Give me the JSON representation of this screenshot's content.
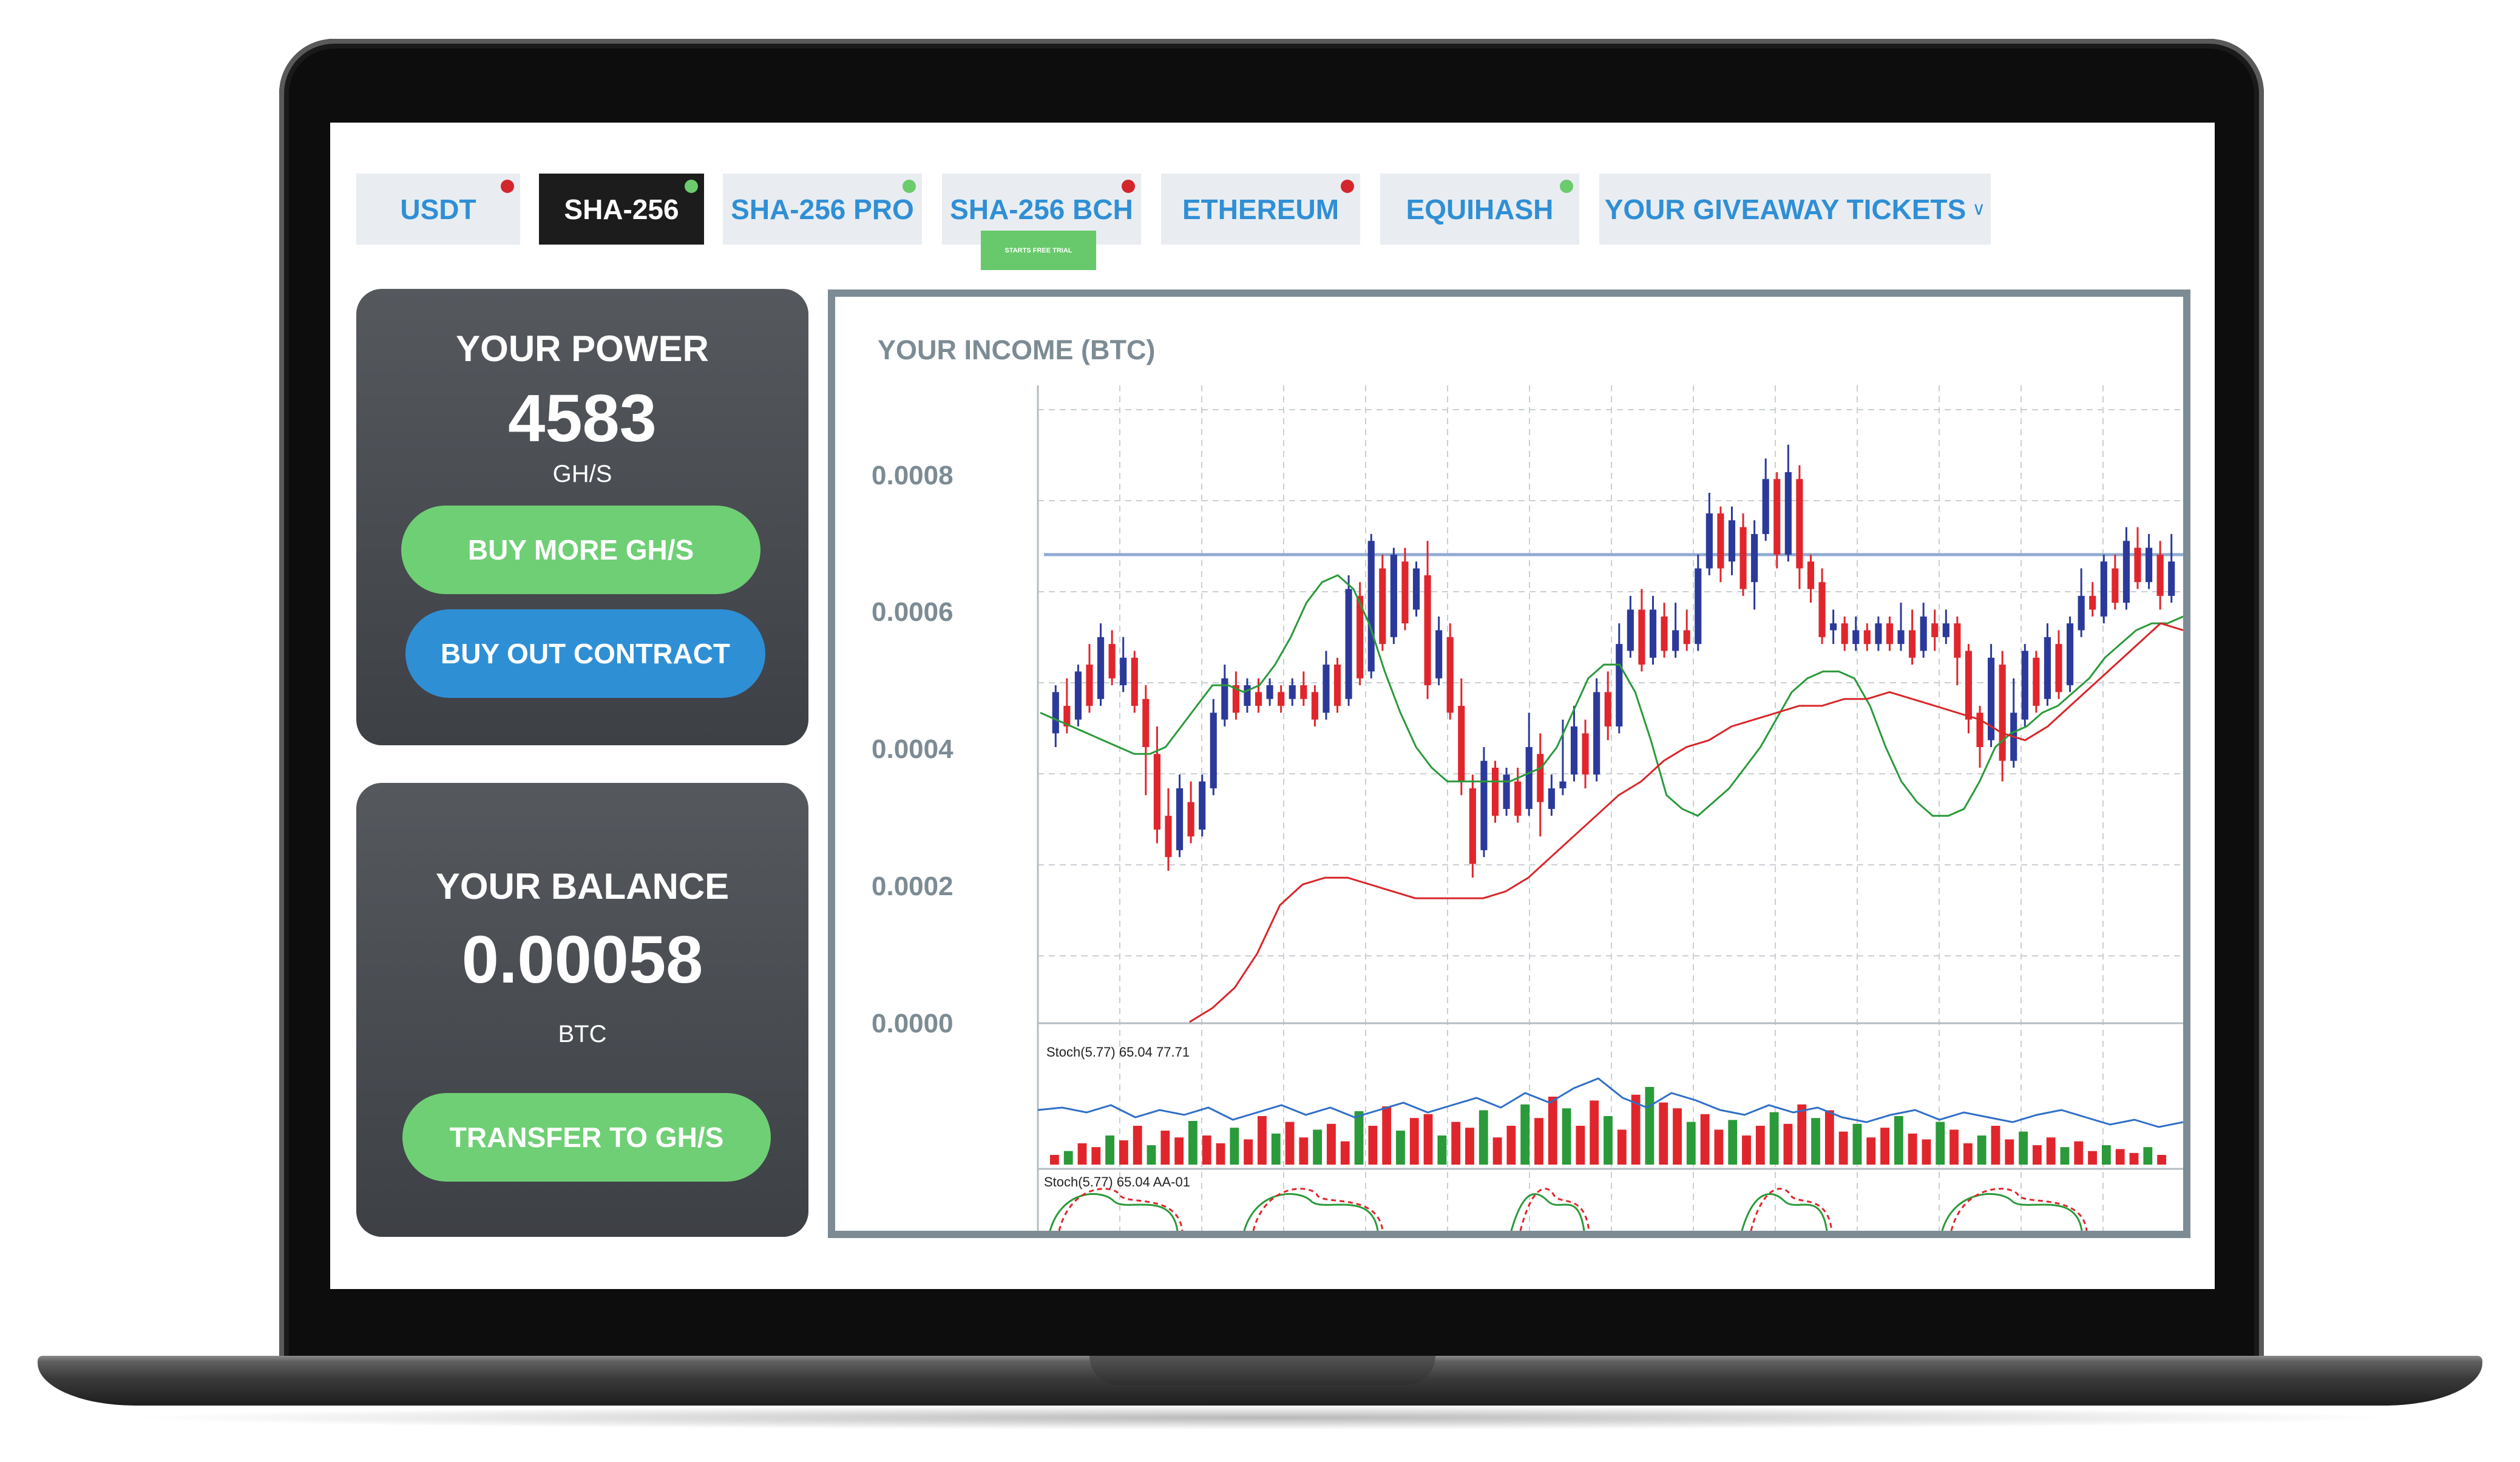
{
  "tabs": [
    {
      "label": "USDT",
      "status": "red",
      "active": false
    },
    {
      "label": "SHA-256",
      "status": "green",
      "active": true
    },
    {
      "label": "SHA-256 PRO",
      "status": "green",
      "active": false
    },
    {
      "label": "SHA-256 BCH",
      "status": "red",
      "active": false,
      "badge": "STARTS FREE TRIAL"
    },
    {
      "label": "ETHEREUM",
      "status": "red",
      "active": false
    },
    {
      "label": "EQUIHASH",
      "status": "green",
      "active": false
    },
    {
      "label": "YOUR GIVEAWAY TICKETS",
      "status": null,
      "active": false,
      "dropdown": true
    }
  ],
  "power": {
    "label": "YOUR POWER",
    "value": "4583",
    "unit": "GH/S",
    "buy_more_label": "BUY MORE GH/S",
    "buy_out_label": "BUY OUT CONTRACT"
  },
  "balance": {
    "label": "YOUR BALANCE",
    "value": "0.00058",
    "unit": "BTC",
    "transfer_label": "TRANSFER TO GH/S"
  },
  "chart": {
    "title": "YOUR INCOME (BTC)",
    "y_ticks": [
      "0.0008",
      "0.0006",
      "0.0004",
      "0.0002",
      "0.0000"
    ],
    "indicator1_label": "Stoch(5.77) 65.04 77.71",
    "indicator2_label": "Stoch(5.77) 65.04 AA-01"
  },
  "chart_data": {
    "type": "candlestick",
    "title": "YOUR INCOME (BTC)",
    "ylim": [
      0,
      0.00095
    ],
    "y_ticks": [
      0.0008,
      0.0006,
      0.0004,
      0.0002,
      0.0
    ],
    "reference_line": 0.00068,
    "grid": true,
    "colors": {
      "up": "#2b3a9a",
      "down": "#e0262c",
      "band": "#2a9a3a",
      "signal": "#d8262a",
      "ref": "#8faad4"
    },
    "candles": [
      [
        0.00042,
        0.00048,
        0.00049,
        0.0004
      ],
      [
        0.00046,
        0.00043,
        0.0005,
        0.00042
      ],
      [
        0.00044,
        0.00051,
        0.00052,
        0.00043
      ],
      [
        0.00052,
        0.00046,
        0.00055,
        0.00045
      ],
      [
        0.00047,
        0.00056,
        0.00058,
        0.00046
      ],
      [
        0.00055,
        0.0005,
        0.00057,
        0.00049
      ],
      [
        0.00049,
        0.00053,
        0.00056,
        0.00048
      ],
      [
        0.00053,
        0.00046,
        0.00054,
        0.00045
      ],
      [
        0.00047,
        0.0004,
        0.00049,
        0.00033
      ],
      [
        0.00039,
        0.00028,
        0.00043,
        0.00026
      ],
      [
        0.0003,
        0.00024,
        0.00034,
        0.00022
      ],
      [
        0.00025,
        0.00034,
        0.00036,
        0.00024
      ],
      [
        0.00032,
        0.00027,
        0.00035,
        0.00026
      ],
      [
        0.00028,
        0.00035,
        0.00036,
        0.00027
      ],
      [
        0.00034,
        0.00045,
        0.00047,
        0.00033
      ],
      [
        0.00044,
        0.0005,
        0.00052,
        0.00043
      ],
      [
        0.00049,
        0.00045,
        0.00051,
        0.00044
      ],
      [
        0.00046,
        0.00049,
        0.0005,
        0.00045
      ],
      [
        0.00048,
        0.00046,
        0.0005,
        0.00045
      ],
      [
        0.00047,
        0.00049,
        0.0005,
        0.00046
      ],
      [
        0.00048,
        0.00046,
        0.00049,
        0.00045
      ],
      [
        0.00047,
        0.00049,
        0.0005,
        0.00046
      ],
      [
        0.00049,
        0.00047,
        0.00051,
        0.00046
      ],
      [
        0.00048,
        0.00044,
        0.00049,
        0.00043
      ],
      [
        0.00045,
        0.00052,
        0.00054,
        0.00044
      ],
      [
        0.00052,
        0.00046,
        0.00053,
        0.00045
      ],
      [
        0.00047,
        0.00063,
        0.00065,
        0.00046
      ],
      [
        0.00062,
        0.0005,
        0.00064,
        0.00049
      ],
      [
        0.00051,
        0.0007,
        0.00071,
        0.0005
      ],
      [
        0.00066,
        0.00055,
        0.00068,
        0.00054
      ],
      [
        0.00056,
        0.00068,
        0.00069,
        0.00055
      ],
      [
        0.00067,
        0.00058,
        0.00069,
        0.00057
      ],
      [
        0.0006,
        0.00066,
        0.00067,
        0.00059
      ],
      [
        0.00065,
        0.00049,
        0.0007,
        0.00047
      ],
      [
        0.0005,
        0.00057,
        0.00059,
        0.00049
      ],
      [
        0.00056,
        0.00045,
        0.00058,
        0.00044
      ],
      [
        0.00046,
        0.00035,
        0.0005,
        0.00033
      ],
      [
        0.00034,
        0.00023,
        0.00036,
        0.00021
      ],
      [
        0.00025,
        0.00038,
        0.0004,
        0.00024
      ],
      [
        0.00037,
        0.0003,
        0.00038,
        0.00029
      ],
      [
        0.00031,
        0.00036,
        0.00037,
        0.0003
      ],
      [
        0.00035,
        0.0003,
        0.00037,
        0.00029
      ],
      [
        0.00031,
        0.0004,
        0.00045,
        0.0003
      ],
      [
        0.00039,
        0.00032,
        0.00042,
        0.00027
      ],
      [
        0.00031,
        0.00034,
        0.00036,
        0.0003
      ],
      [
        0.00034,
        0.00035,
        0.00044,
        0.00033
      ],
      [
        0.00036,
        0.00043,
        0.00046,
        0.00035
      ],
      [
        0.00042,
        0.00036,
        0.00044,
        0.00034
      ],
      [
        0.00036,
        0.00048,
        0.0005,
        0.00035
      ],
      [
        0.00048,
        0.00043,
        0.00051,
        0.00041
      ],
      [
        0.00043,
        0.00055,
        0.00058,
        0.00042
      ],
      [
        0.00054,
        0.0006,
        0.00062,
        0.00053
      ],
      [
        0.0006,
        0.00052,
        0.00063,
        0.00051
      ],
      [
        0.00053,
        0.0006,
        0.00062,
        0.00052
      ],
      [
        0.00059,
        0.00054,
        0.00061,
        0.00053
      ],
      [
        0.00054,
        0.00057,
        0.00061,
        0.00053
      ],
      [
        0.00057,
        0.00055,
        0.0006,
        0.00054
      ],
      [
        0.00055,
        0.00066,
        0.00068,
        0.00054
      ],
      [
        0.00066,
        0.00074,
        0.00077,
        0.00065
      ],
      [
        0.00074,
        0.00066,
        0.00075,
        0.00064
      ],
      [
        0.00067,
        0.00073,
        0.00075,
        0.00065
      ],
      [
        0.00072,
        0.00063,
        0.00074,
        0.00062
      ],
      [
        0.00064,
        0.00071,
        0.00073,
        0.0006
      ],
      [
        0.00071,
        0.00079,
        0.00082,
        0.0007
      ],
      [
        0.00079,
        0.00068,
        0.0008,
        0.00066
      ],
      [
        0.00068,
        0.0008,
        0.00084,
        0.00067
      ],
      [
        0.00079,
        0.00066,
        0.00081,
        0.00063
      ],
      [
        0.00067,
        0.00063,
        0.00068,
        0.00061
      ],
      [
        0.00064,
        0.00056,
        0.00066,
        0.00055
      ],
      [
        0.00057,
        0.00058,
        0.0006,
        0.00055
      ],
      [
        0.00058,
        0.00055,
        0.00059,
        0.00054
      ],
      [
        0.00055,
        0.00057,
        0.00059,
        0.00054
      ],
      [
        0.00057,
        0.00055,
        0.00058,
        0.00054
      ],
      [
        0.00055,
        0.00058,
        0.00059,
        0.00054
      ],
      [
        0.00058,
        0.00055,
        0.00059,
        0.00054
      ],
      [
        0.00055,
        0.00057,
        0.00061,
        0.00054
      ],
      [
        0.00057,
        0.00053,
        0.0006,
        0.00052
      ],
      [
        0.00054,
        0.00059,
        0.00061,
        0.00053
      ],
      [
        0.00058,
        0.00056,
        0.0006,
        0.00054
      ],
      [
        0.00056,
        0.00058,
        0.0006,
        0.00055
      ],
      [
        0.00058,
        0.00053,
        0.00059,
        0.00049
      ],
      [
        0.00054,
        0.00044,
        0.00055,
        0.00042
      ],
      [
        0.00045,
        0.0004,
        0.00046,
        0.00037
      ],
      [
        0.00041,
        0.00053,
        0.00055,
        0.0004
      ],
      [
        0.00052,
        0.00038,
        0.00054,
        0.00035
      ],
      [
        0.00038,
        0.00045,
        0.0005,
        0.00037
      ],
      [
        0.00044,
        0.00054,
        0.00055,
        0.00043
      ],
      [
        0.00053,
        0.00046,
        0.00054,
        0.00045
      ],
      [
        0.00047,
        0.00056,
        0.00058,
        0.00046
      ],
      [
        0.00055,
        0.00048,
        0.00057,
        0.00047
      ],
      [
        0.00049,
        0.00058,
        0.00059,
        0.00048
      ],
      [
        0.00057,
        0.00062,
        0.00066,
        0.00056
      ],
      [
        0.00062,
        0.0006,
        0.00064,
        0.00059
      ],
      [
        0.00059,
        0.00067,
        0.00068,
        0.00058
      ],
      [
        0.00066,
        0.00061,
        0.00068,
        0.0006
      ],
      [
        0.00061,
        0.0007,
        0.00072,
        0.0006
      ],
      [
        0.00069,
        0.00064,
        0.00072,
        0.00063
      ],
      [
        0.00064,
        0.00069,
        0.00071,
        0.00063
      ],
      [
        0.00068,
        0.00062,
        0.0007,
        0.0006
      ],
      [
        0.00062,
        0.00067,
        0.00071,
        0.00061
      ]
    ],
    "upper_band": [
      0.00045,
      0.00044,
      0.00043,
      0.00042,
      0.00041,
      0.0004,
      0.00039,
      0.00039,
      0.0004,
      0.00043,
      0.00046,
      0.00049,
      0.00049,
      0.00048,
      0.00049,
      0.00052,
      0.00056,
      0.00061,
      0.00064,
      0.00065,
      0.00063,
      0.00058,
      0.00051,
      0.00045,
      0.0004,
      0.00037,
      0.00035,
      0.00035,
      0.00035,
      0.00035,
      0.00035,
      0.00036,
      0.00037,
      0.0004,
      0.00045,
      0.0005,
      0.00052,
      0.00052,
      0.00048,
      0.00041,
      0.00033,
      0.00031,
      0.0003,
      0.00032,
      0.00034,
      0.00037,
      0.0004,
      0.00044,
      0.00048,
      0.0005,
      0.00051,
      0.00051,
      0.0005,
      0.00046,
      0.0004,
      0.00035,
      0.00032,
      0.0003,
      0.0003,
      0.00031,
      0.00035,
      0.0004,
      0.00042,
      0.00043,
      0.00045,
      0.00046,
      0.00048,
      0.0005,
      0.00053,
      0.00055,
      0.00057,
      0.00058,
      0.00058,
      0.00059
    ],
    "signal_line": [
      0.0,
      2e-05,
      5e-05,
      0.0001,
      0.00017,
      0.0002,
      0.00021,
      0.00021,
      0.0002,
      0.00019,
      0.00018,
      0.00018,
      0.00018,
      0.00018,
      0.00019,
      0.00021,
      0.00024,
      0.00027,
      0.0003,
      0.00033,
      0.00035,
      0.00038,
      0.0004,
      0.00041,
      0.00043,
      0.00044,
      0.00045,
      0.00046,
      0.00046,
      0.00047,
      0.00047,
      0.00048,
      0.00047,
      0.00046,
      0.00045,
      0.00044,
      0.00042,
      0.00041,
      0.00043,
      0.00046,
      0.00049,
      0.00052,
      0.00055,
      0.00058,
      0.00057
    ],
    "stoch_bars": [
      10,
      14,
      22,
      18,
      30,
      25,
      40,
      20,
      35,
      28,
      45,
      30,
      22,
      38,
      26,
      50,
      32,
      44,
      28,
      36,
      42,
      24,
      55,
      40,
      60,
      35,
      48,
      52,
      30,
      44,
      38,
      56,
      28,
      40,
      62,
      48,
      70,
      58,
      40,
      66,
      50,
      36,
      72,
      80,
      64,
      58,
      44,
      52,
      36,
      46,
      30,
      40,
      54,
      42,
      62,
      48,
      56,
      34,
      42,
      28,
      38,
      50,
      32,
      26,
      44,
      36,
      22,
      30,
      40,
      26,
      34,
      20,
      28,
      18,
      24,
      14,
      20,
      16,
      12,
      18,
      10
    ],
    "stoch_line": [
      65,
      66,
      64,
      67,
      62,
      65,
      63,
      66,
      61,
      64,
      67,
      63,
      66,
      62,
      65,
      68,
      64,
      67,
      70,
      66,
      72,
      68,
      74,
      78,
      70,
      66,
      72,
      69,
      65,
      63,
      67,
      64,
      66,
      62,
      60,
      63,
      65,
      61,
      64,
      62,
      60,
      63,
      65,
      62,
      59,
      61,
      58,
      60
    ]
  }
}
